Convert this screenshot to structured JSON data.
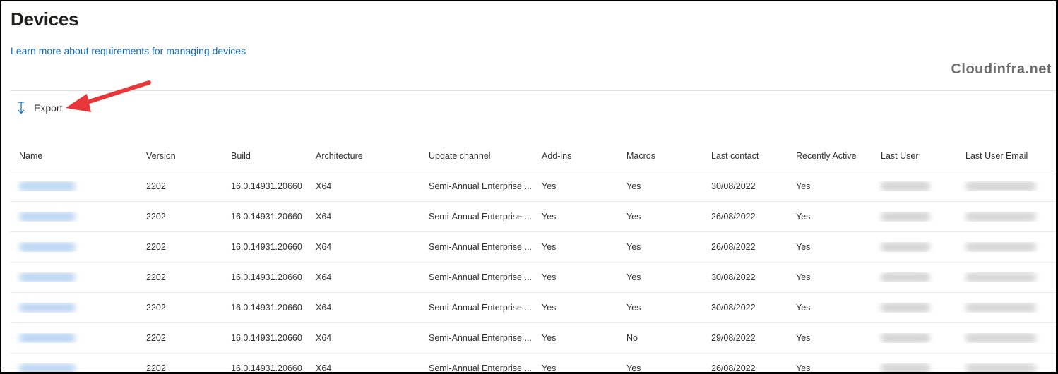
{
  "header": {
    "title": "Devices",
    "learn_link": "Learn more about requirements for managing devices",
    "watermark": "Cloudinfra.net"
  },
  "toolbar": {
    "export_label": "Export",
    "export_icon": "download-arrow-icon"
  },
  "colors": {
    "link": "#0f6cbd",
    "annotation_arrow": "#e8373b",
    "accent": "#0f6cbd"
  },
  "table": {
    "columns": [
      "Name",
      "Version",
      "Build",
      "Architecture",
      "Update channel",
      "Add-ins",
      "Macros",
      "Last contact",
      "Recently Active",
      "Last User",
      "Last User Email"
    ],
    "rows": [
      {
        "version": "2202",
        "build": "16.0.14931.20660",
        "arch": "X64",
        "channel": "Semi-Annual Enterprise ...",
        "addins": "Yes",
        "macros": "Yes",
        "last_contact": "30/08/2022",
        "recently_active": "Yes"
      },
      {
        "version": "2202",
        "build": "16.0.14931.20660",
        "arch": "X64",
        "channel": "Semi-Annual Enterprise ...",
        "addins": "Yes",
        "macros": "Yes",
        "last_contact": "26/08/2022",
        "recently_active": "Yes"
      },
      {
        "version": "2202",
        "build": "16.0.14931.20660",
        "arch": "X64",
        "channel": "Semi-Annual Enterprise ...",
        "addins": "Yes",
        "macros": "Yes",
        "last_contact": "26/08/2022",
        "recently_active": "Yes"
      },
      {
        "version": "2202",
        "build": "16.0.14931.20660",
        "arch": "X64",
        "channel": "Semi-Annual Enterprise ...",
        "addins": "Yes",
        "macros": "Yes",
        "last_contact": "30/08/2022",
        "recently_active": "Yes"
      },
      {
        "version": "2202",
        "build": "16.0.14931.20660",
        "arch": "X64",
        "channel": "Semi-Annual Enterprise ...",
        "addins": "Yes",
        "macros": "Yes",
        "last_contact": "30/08/2022",
        "recently_active": "Yes"
      },
      {
        "version": "2202",
        "build": "16.0.14931.20660",
        "arch": "X64",
        "channel": "Semi-Annual Enterprise ...",
        "addins": "Yes",
        "macros": "No",
        "last_contact": "29/08/2022",
        "recently_active": "Yes"
      },
      {
        "version": "2202",
        "build": "16.0.14931.20660",
        "arch": "X64",
        "channel": "Semi-Annual Enterprise ...",
        "addins": "Yes",
        "macros": "Yes",
        "last_contact": "26/08/2022",
        "recently_active": "Yes"
      }
    ]
  }
}
